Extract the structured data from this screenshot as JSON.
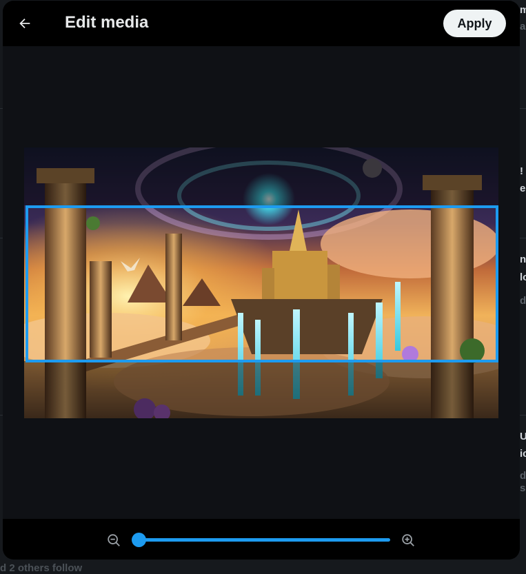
{
  "header": {
    "title": "Edit media",
    "apply_label": "Apply"
  },
  "crop": {
    "zoom_level": 0.0,
    "aspect": "3:1"
  },
  "background_page": {
    "fragment_texts": [
      "m",
      "a",
      "!",
      "e",
      "n",
      "lo",
      "di",
      "U",
      "ic",
      "di",
      "s"
    ],
    "bottom_text": "d 2 others follow"
  },
  "colors": {
    "accent": "#1d9bf0",
    "header_bg": "#000000",
    "canvas_bg": "#0f1115",
    "apply_bg": "#eff3f4"
  },
  "icons": {
    "back": "arrow-left-icon",
    "zoom_out": "zoom-out-icon",
    "zoom_in": "zoom-in-icon"
  }
}
